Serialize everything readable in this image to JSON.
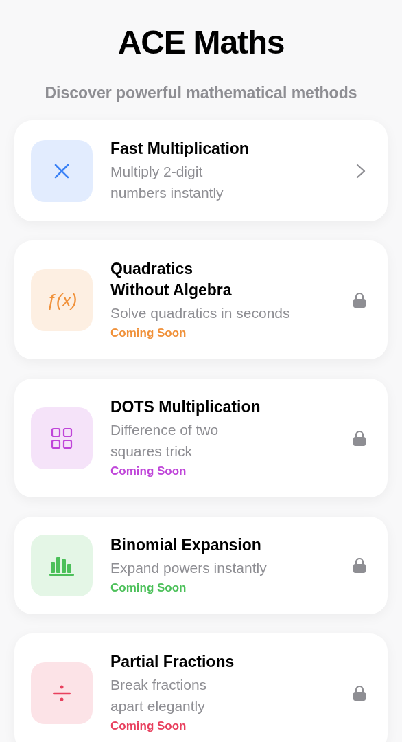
{
  "header": {
    "title": "ACE Maths",
    "subtitle": "Discover powerful mathematical methods"
  },
  "methods": [
    {
      "kind": "multiply",
      "title": "Fast Multiplication",
      "description": "Multiply 2-digit\nnumbers instantly",
      "locked": false,
      "color": "#3b82f6"
    },
    {
      "kind": "function",
      "icon_text": "ƒ(x)",
      "title": "Quadratics\nWithout Algebra",
      "description": "Solve quadratics in seconds",
      "status": "Coming Soon",
      "locked": true,
      "color": "#f0913a"
    },
    {
      "kind": "grid",
      "title": "DOTS Multiplication",
      "description": "Difference of two\nsquares trick",
      "status": "Coming Soon",
      "locked": true,
      "color": "#bf45d9"
    },
    {
      "kind": "chart",
      "title": "Binomial Expansion",
      "description": "Expand powers instantly",
      "status": "Coming Soon",
      "locked": true,
      "color": "#4cc05a"
    },
    {
      "kind": "divide",
      "title": "Partial Fractions",
      "description": "Break fractions\napart elegantly",
      "status": "Coming Soon",
      "locked": true,
      "color": "#e8405e"
    }
  ]
}
